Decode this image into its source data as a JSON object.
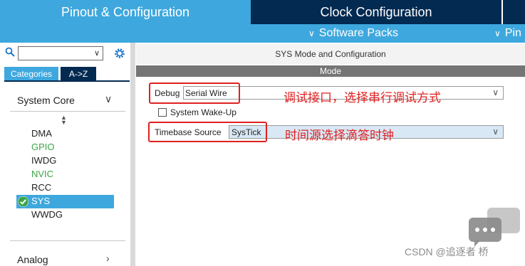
{
  "tabs": {
    "pinout": "Pinout & Configuration",
    "clock": "Clock Configuration",
    "more": ""
  },
  "subbar": {
    "software_packs": "Software Packs",
    "pinout": "Pin"
  },
  "left": {
    "categories_tab": "Categories",
    "az_tab": "A->Z",
    "group_system_core": "System Core",
    "group_analog": "Analog",
    "peripherals": [
      {
        "label": "DMA",
        "color": "#222222"
      },
      {
        "label": "GPIO",
        "color": "#3AA544"
      },
      {
        "label": "IWDG",
        "color": "#222222"
      },
      {
        "label": "NVIC",
        "color": "#3AA544"
      },
      {
        "label": "RCC",
        "color": "#222222"
      },
      {
        "label": "SYS",
        "selected": true
      },
      {
        "label": "WWDG",
        "color": "#222222"
      }
    ]
  },
  "right": {
    "panel_title": "SYS Mode and Configuration",
    "mode_header": "Mode",
    "debug_label": "Debug",
    "debug_value": "Serial Wire",
    "wakeup_label": "System Wake-Up",
    "timebase_label": "Timebase Source",
    "timebase_value": "SysTick"
  },
  "annotations": {
    "debug_note": "调试接口，选择串行调试方式",
    "timebase_note": "时间源选择滴答时钟"
  },
  "watermark": "CSDN @追逐者 桥",
  "colors": {
    "accent_blue": "#3EA8DE",
    "dark_navy": "#032A51",
    "annotation_red": "#E02020",
    "green": "#3AA544"
  }
}
